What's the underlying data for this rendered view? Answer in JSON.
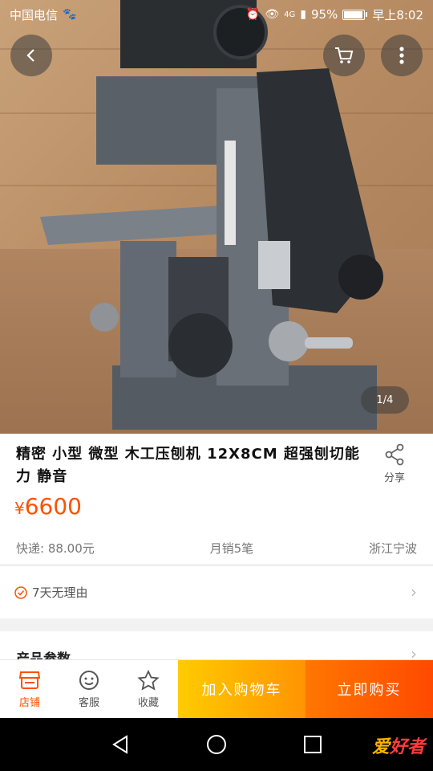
{
  "status_bar": {
    "carrier": "中国电信",
    "network": "4G",
    "battery": "95%",
    "time": "早上8:02"
  },
  "gallery": {
    "page_indicator": "1/4"
  },
  "product": {
    "title": "精密 小型 微型 木工压刨机 12X8CM 超强刨切能力 静音",
    "share_label": "分享",
    "price_symbol": "¥",
    "price": "6600",
    "shipping": "快递: 88.00元",
    "monthly_sales": "月销5笔",
    "location": "浙江宁波"
  },
  "guarantee": {
    "label": "7天无理由"
  },
  "params": {
    "label": "产品参数"
  },
  "action_bar": {
    "shop_label": "店铺",
    "service_label": "客服",
    "favorite_label": "收藏",
    "add_cart_label": "加入购物车",
    "buy_now_label": "立即购买"
  },
  "watermark": {
    "text_a": "爱",
    "text_b": "好者"
  },
  "colors": {
    "accent": "#ff5000",
    "cart_button": "#ffa800",
    "buy_button": "#ff5a00"
  }
}
